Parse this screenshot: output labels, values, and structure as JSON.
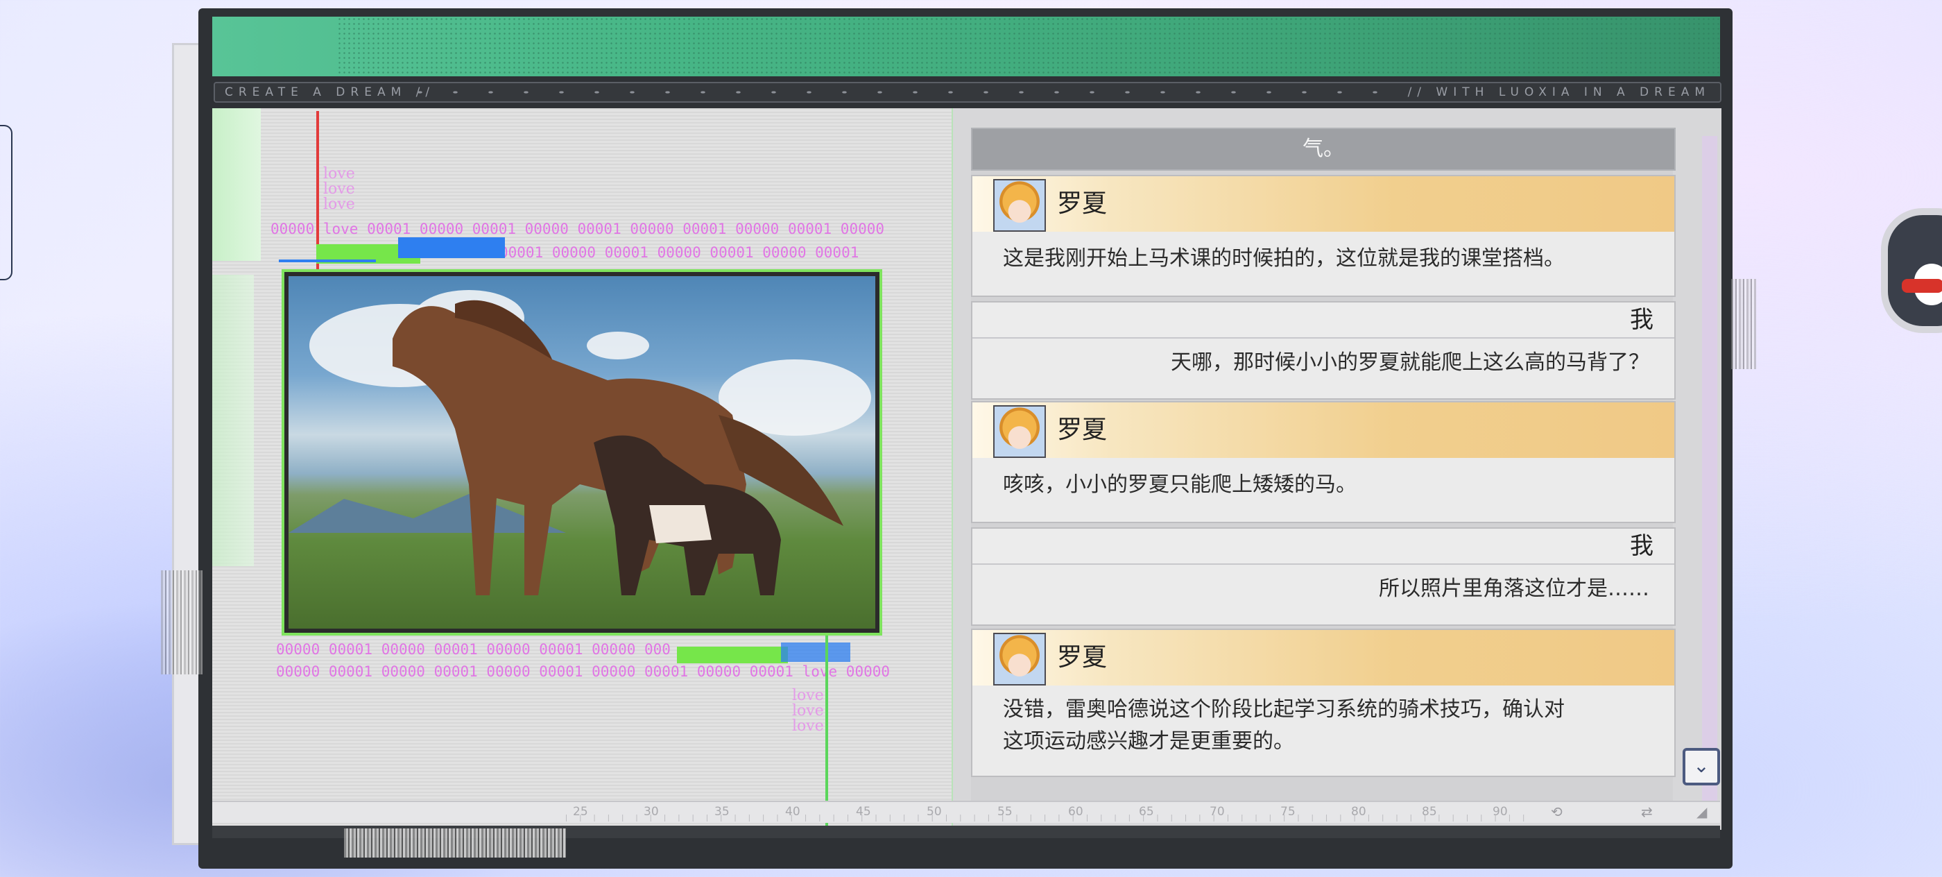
{
  "window": {
    "marquee_left": "CREATE A DREAM //",
    "marquee_right": "// WITH LUOXIA IN A DREAM"
  },
  "photo": {
    "binary_top_1": "00000 love 00001 00000 00001 00000 00001 00000 00001 00000 00001 00000",
    "binary_top_2": "00001 00000 00001 00000 00001 00000 00001",
    "binary_bottom_1": "00000 00001 00000 00001 00000 00001 00000 000",
    "binary_bottom_2": "00000 00001 00000 00001 00000 00001 00000 00001 00000 00001 love 00000",
    "love_word": "love"
  },
  "dialog": {
    "top_fragment": "气。",
    "entries": [
      {
        "speaker": "罗夏",
        "text": "这是我刚开始上马术课的时候拍的，这位就是我的课堂搭档。"
      },
      {
        "speaker": "我",
        "text": "天哪，那时候小小的罗夏就能爬上这么高的马背了？"
      },
      {
        "speaker": "罗夏",
        "text": "咳咳，小小的罗夏只能爬上矮矮的马。"
      },
      {
        "speaker": "我",
        "text": "所以照片里角落这位才是……"
      },
      {
        "speaker": "罗夏",
        "text": "没错，雷奥哈德说这个阶段比起学习系统的骑术技巧，确认对",
        "text2": "这项运动感兴趣才是更重要的。"
      }
    ],
    "scroll_icon": "chevron-down-icon"
  },
  "ruler": {
    "ticks": [
      "25",
      "30",
      "35",
      "40",
      "45",
      "50",
      "55",
      "60",
      "65",
      "70",
      "75",
      "80",
      "85",
      "90"
    ]
  },
  "colors": {
    "accent_green": "#47b686",
    "speaker_gold": "#f1cf8e",
    "glitch_pink": "#e16be6"
  }
}
